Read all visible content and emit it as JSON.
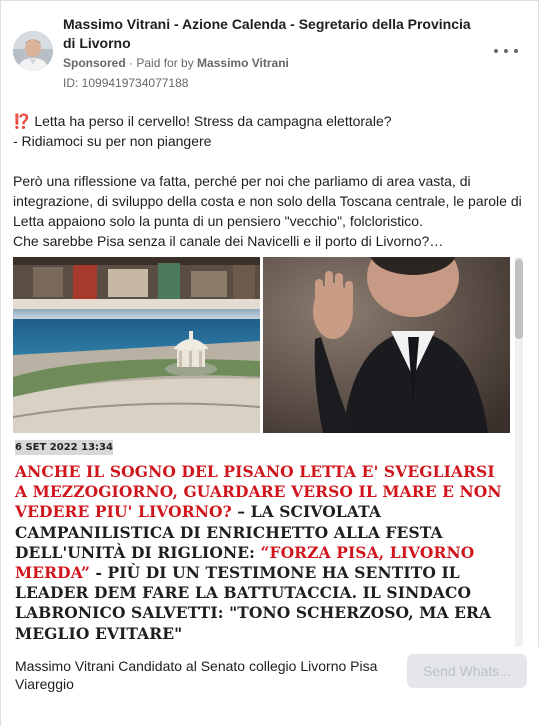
{
  "post": {
    "page_name": "Massimo Vitrani - Azione Calenda - Segretario della Provincia di Livorno",
    "sponsored_label": "Sponsored",
    "separator": " · ",
    "paid_for_prefix": "Paid for by ",
    "paid_for_name": "Massimo Vitrani",
    "ad_id": "ID: 1099419734077188",
    "more_icon": "more-horizontal-icon",
    "body_lines_1": [
      "⁉️ Letta ha perso il cervello! Stress da campagna elettorale?",
      "- Ridiamoci su per non piangere"
    ],
    "body_paragraph_2": "Però una riflessione va fatta, perché per noi che parliamo di area vasta, di integrazione, di sviluppo della costa e non solo della Toscana centrale, le parole di Letta appaiono solo la punta di un pensiero \"vecchio\", folcloristico.",
    "body_last_line": "Che sarebbe Pisa senza il canale dei Navicelli e il porto di Livorno?…"
  },
  "media": {
    "date": "6 SET 2022 13:34",
    "headline_red_1": "ANCHE IL SOGNO DEL PISANO LETTA E' SVEGLIARSI A MEZZOGIORNO, GUARDARE VERSO IL MARE E NON VEDERE PIU' LIVORNO?",
    "headline_dark_1": " – LA SCIVOLATA CAMPANILISTICA DI ENRICHETTO ALLA FESTA DELL'UNITÀ DI RIGLIONE: ",
    "headline_red_2": "“FORZA PISA, LIVORNO MERDA”",
    "headline_dark_2": " - PIÙ DI UN TESTIMONE HA SENTITO IL LEADER DEM FARE LA BATTUTACCIA. IL SINDACO LABRONICO SALVETTI: \"TONO SCHERZOSO, MA ERA MEGLIO EVITARE\""
  },
  "footer": {
    "cta_text": "Massimo Vitrani Candidato al Senato collegio Livorno Pisa Viareggio",
    "button_label": "Send Whats..."
  },
  "colors": {
    "headline_red": "#d0161c",
    "headline_dark": "#1e1e1e",
    "meta_grey": "#65676b",
    "button_bg": "#e4e6eb"
  }
}
